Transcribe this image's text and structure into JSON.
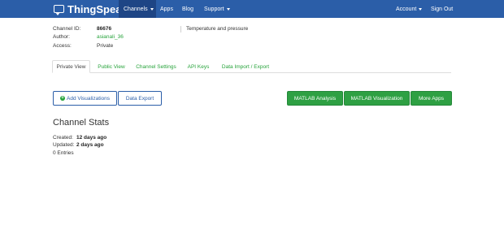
{
  "navbar": {
    "brand": "ThingSpeak",
    "items": [
      {
        "label": "Channels",
        "dropdown": true,
        "active": true
      },
      {
        "label": "Apps"
      },
      {
        "label": "Blog"
      },
      {
        "label": "Support",
        "dropdown": true
      }
    ],
    "right_items": [
      {
        "label": "Account",
        "dropdown": true
      },
      {
        "label": "Sign Out"
      }
    ],
    "colors": {
      "bar": "#2b5ea8",
      "active": "#1e4585"
    }
  },
  "channel_info": {
    "id_label": "Channel ID:",
    "id_value": "86676",
    "author_label": "Author:",
    "author_value": "asianali_36",
    "access_label": "Access:",
    "access_value": "Private",
    "description": "Temperature and pressure"
  },
  "tabs": [
    {
      "label": "Private View",
      "active": true
    },
    {
      "label": "Public View"
    },
    {
      "label": "Channel Settings"
    },
    {
      "label": "API Keys"
    },
    {
      "label": "Data Import / Export"
    }
  ],
  "buttons": {
    "add_visualizations": "Add Visualizations",
    "data_export": "Data Export",
    "matlab_analysis": "MATLAB Analysis",
    "matlab_visualization": "MATLAB Visualization",
    "more_apps": "More Apps"
  },
  "stats": {
    "title": "Channel Stats",
    "created_label": "Created:",
    "created_value": "12 days ago",
    "updated_label": "Updated:",
    "updated_value": "2 days ago",
    "entries": "0 Entries"
  },
  "accent_colors": {
    "link_green": "#27a33b",
    "button_green": "#2ea043",
    "primary_blue": "#2b5ea8"
  }
}
